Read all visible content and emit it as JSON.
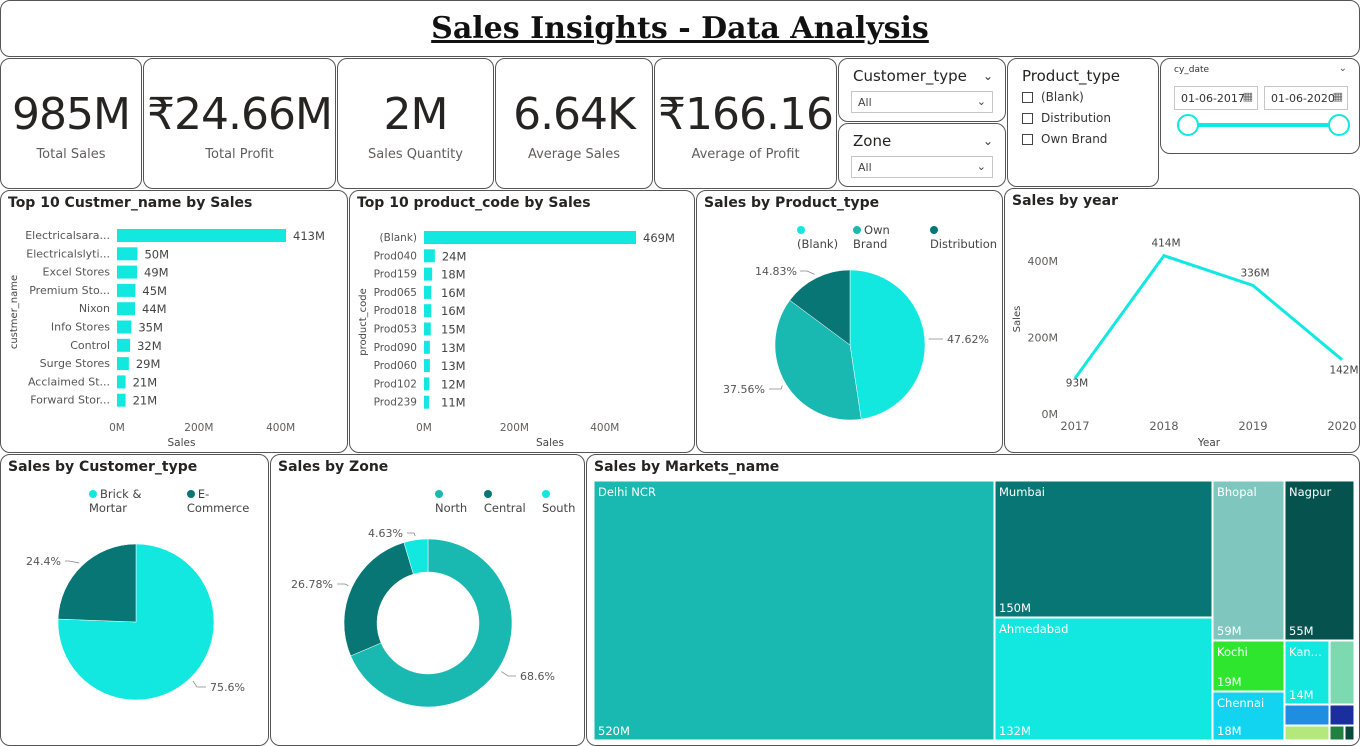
{
  "title": "Sales Insights - Data Analysis",
  "kpis": [
    {
      "value": "985M",
      "label": "Total Sales"
    },
    {
      "value": "₹24.66M",
      "label": "Total Profit"
    },
    {
      "value": "2M",
      "label": "Sales Quantity"
    },
    {
      "value": "6.64K",
      "label": "Average Sales"
    },
    {
      "value": "₹166.16",
      "label": "Average of Profit"
    }
  ],
  "slicers": {
    "customer_type": {
      "title": "Customer_type",
      "value": "All"
    },
    "zone": {
      "title": "Zone",
      "value": "All"
    },
    "product_type": {
      "title": "Product_type",
      "options": [
        "(Blank)",
        "Distribution",
        "Own Brand"
      ]
    },
    "cy_date": {
      "title": "cy_date",
      "start": "01-06-2017",
      "end": "01-06-2020"
    }
  },
  "visuals": {
    "customers": {
      "title": "Top 10 Custmer_name by Sales",
      "y_axis": "custmer_name",
      "x_axis": "Sales",
      "ticks": [
        "0M",
        "200M",
        "400M"
      ]
    },
    "products": {
      "title": "Top 10 product_code by Sales",
      "y_axis": "product_code",
      "x_axis": "Sales",
      "ticks": [
        "0M",
        "200M",
        "400M"
      ]
    },
    "product_type": {
      "title": "Sales by Product_type",
      "legend": [
        "(Blank)",
        "Own Brand",
        "Distribution"
      ]
    },
    "year": {
      "title": "Sales by year",
      "y_axis": "Sales",
      "x_axis": "Year",
      "yticks": [
        "400M",
        "200M",
        "0M"
      ]
    },
    "customer_type": {
      "title": "Sales by Customer_type",
      "legend": [
        "Brick & Mortar",
        "E-Commerce"
      ]
    },
    "zone": {
      "title": "Sales by Zone",
      "legend": [
        "North",
        "Central",
        "South"
      ]
    },
    "markets": {
      "title": "Sales by Markets_name"
    }
  },
  "colors": {
    "cyan": "#12e8e0",
    "teal": "#19b8b0",
    "dark_teal": "#087675",
    "darkest": "#05524e"
  },
  "chart_data": [
    {
      "type": "bar",
      "orientation": "horizontal",
      "title": "Top 10 Custmer_name by Sales",
      "ylabel": "custmer_name",
      "xlabel": "Sales",
      "categories": [
        "Electricalsara...",
        "Electricalslyti...",
        "Excel Stores",
        "Premium Sto...",
        "Nixon",
        "Info Stores",
        "Control",
        "Surge Stores",
        "Acclaimed St...",
        "Forward Stor..."
      ],
      "values": [
        413,
        50,
        49,
        45,
        44,
        35,
        32,
        29,
        21,
        21
      ],
      "labels": [
        "413M",
        "50M",
        "49M",
        "45M",
        "44M",
        "35M",
        "32M",
        "29M",
        "21M",
        "21M"
      ],
      "xlim": [
        0,
        413
      ]
    },
    {
      "type": "bar",
      "orientation": "horizontal",
      "title": "Top 10 product_code by Sales",
      "ylabel": "product_code",
      "xlabel": "Sales",
      "categories": [
        "(Blank)",
        "Prod040",
        "Prod159",
        "Prod065",
        "Prod018",
        "Prod053",
        "Prod090",
        "Prod060",
        "Prod102",
        "Prod239"
      ],
      "values": [
        469,
        24,
        18,
        16,
        16,
        15,
        13,
        13,
        12,
        11
      ],
      "labels": [
        "469M",
        "24M",
        "18M",
        "16M",
        "16M",
        "15M",
        "13M",
        "13M",
        "12M",
        "11M"
      ],
      "xlim": [
        0,
        469
      ]
    },
    {
      "type": "pie",
      "title": "Sales by Product_type",
      "categories": [
        "(Blank)",
        "Own Brand",
        "Distribution"
      ],
      "values": [
        47.62,
        37.56,
        14.83
      ],
      "labels": [
        "47.62%",
        "37.56%",
        "14.83%"
      ]
    },
    {
      "type": "line",
      "title": "Sales by year",
      "xlabel": "Year",
      "ylabel": "Sales",
      "x": [
        "2017",
        "2018",
        "2019",
        "2020"
      ],
      "values": [
        93,
        414,
        336,
        142
      ],
      "labels": [
        "93M",
        "414M",
        "336M",
        "142M"
      ],
      "ylim": [
        0,
        500
      ]
    },
    {
      "type": "pie",
      "title": "Sales by Customer_type",
      "categories": [
        "Brick & Mortar",
        "E-Commerce"
      ],
      "values": [
        75.6,
        24.4
      ],
      "labels": [
        "75.6%",
        "24.4%"
      ]
    },
    {
      "type": "pie",
      "donut": true,
      "title": "Sales by Zone",
      "categories": [
        "North",
        "Central",
        "South"
      ],
      "values": [
        68.6,
        26.78,
        4.63
      ],
      "labels": [
        "68.6%",
        "26.78%",
        "4.63%"
      ]
    },
    {
      "type": "treemap",
      "title": "Sales by Markets_name",
      "categories": [
        "Delhi NCR",
        "Mumbai",
        "Ahmedabad",
        "Bhopal",
        "Nagpur",
        "Kochi",
        "Kan...",
        "Chennai"
      ],
      "values": [
        520,
        150,
        132,
        59,
        55,
        19,
        14,
        18
      ],
      "labels": [
        "520M",
        "150M",
        "132M",
        "59M",
        "55M",
        "19M",
        "14M",
        "18M"
      ]
    }
  ]
}
